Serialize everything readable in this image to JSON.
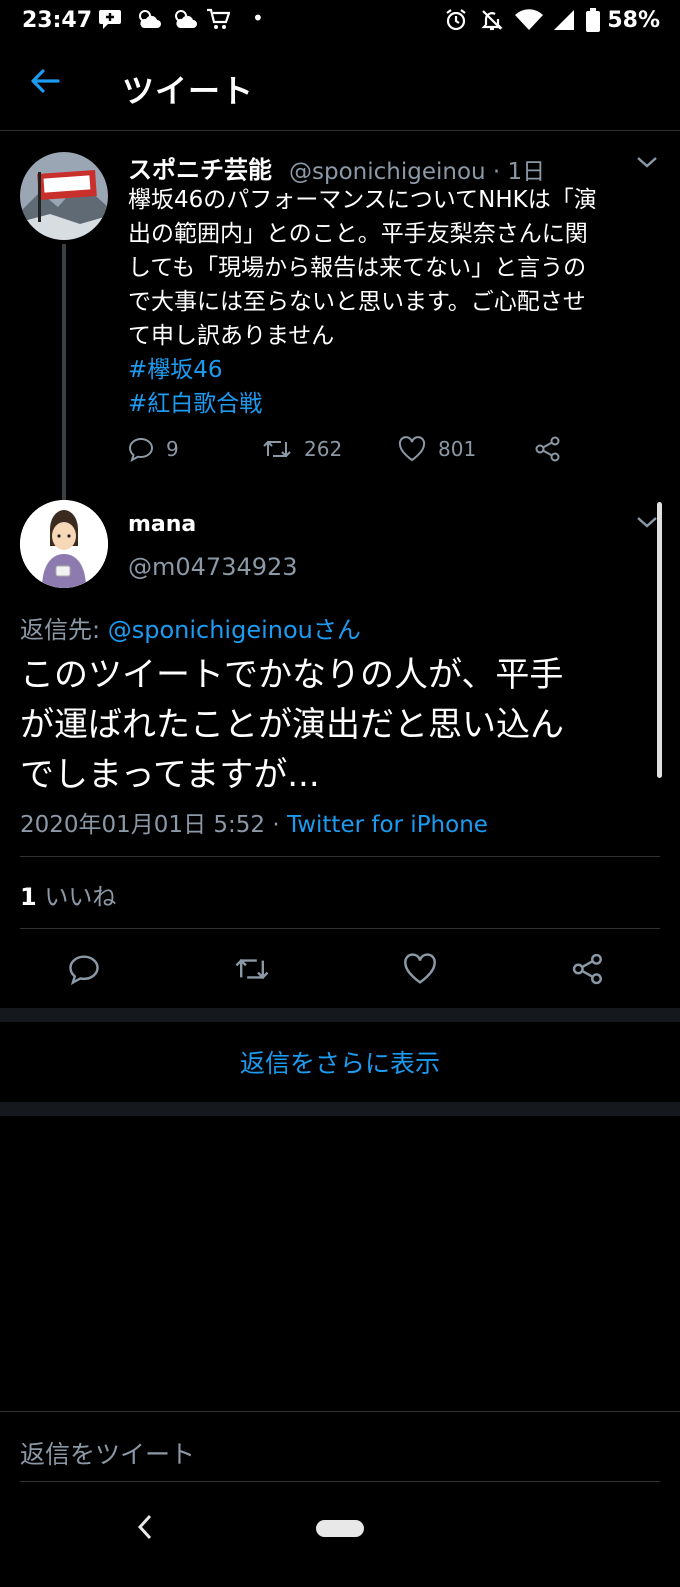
{
  "status_bar": {
    "time": "23:47",
    "battery": "58%"
  },
  "header": {
    "title": "ツイート"
  },
  "tweet1": {
    "name": "スポニチ芸能",
    "handle_time": "@sponichigeinou · 1日",
    "text_lines": [
      "欅坂46のパフォーマンスについてNHKは「演",
      "出の範囲内」とのこと。平手友梨奈さんに関",
      "しても「現場から報告は来てない」と言うの",
      "で大事には至らないと思います。ご心配させ",
      "て申し訳ありません"
    ],
    "hashtags": [
      "#欅坂46",
      "#紅白歌合戦"
    ],
    "replies": "9",
    "retweets": "262",
    "likes": "801"
  },
  "tweet2": {
    "name": "mana",
    "handle": "@m04734923",
    "reply_prefix": "返信先: ",
    "reply_target": "@sponichigeinouさん",
    "text_lines": [
      "このツイートでかなりの人が、平手",
      "が運ばれたことが演出だと思い込ん",
      "でしまってますが..."
    ],
    "datetime": "2020年01月01日 5:52 · ",
    "source": "Twitter for iPhone",
    "like_count": "1",
    "like_label": " いいね"
  },
  "show_more": "返信をさらに表示",
  "compose_placeholder": "返信をツイート",
  "colors": {
    "accent": "#1d9bf0",
    "muted": "#8b98a5",
    "background": "#000000"
  }
}
